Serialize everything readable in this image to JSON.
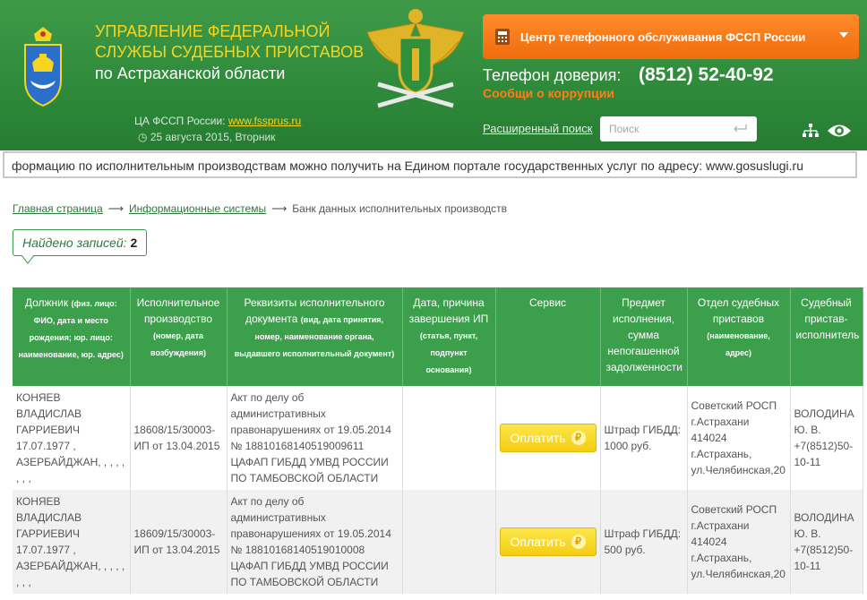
{
  "header": {
    "org_title_line1": "Управление Федеральной",
    "org_title_line2": "службы судебных приставов",
    "org_subtitle": "по Астраханской области",
    "ca_label": "ЦА ФССП России:",
    "ca_link": "www.fssprus.ru",
    "date": "25 августа 2015, Вторник",
    "call_center": "Центр телефонного обслуживания ФССП России",
    "trust_label": "Телефон доверия:",
    "trust_phone": "(8512) 52-40-92",
    "corruption": "Сообщи о коррупции",
    "advanced_search": "Расширенный поиск",
    "search_placeholder": "Поиск"
  },
  "ticker": "формацию по исполнительным производствам можно получить на Едином портале государственных услуг по адресу: www.gosuslugi.ru",
  "breadcrumb": {
    "home": "Главная страница",
    "systems": "Информационные системы",
    "current": "Банк данных исполнительных производств",
    "arrow": "⟶"
  },
  "found": {
    "label": "Найдено записей:",
    "count": "2"
  },
  "table": {
    "headers": [
      {
        "main": "Должник",
        "sub": "(физ. лицо: ФИО, дата и место рождения; юр. лицо: наименование, юр. адрес)"
      },
      {
        "main": "Исполнительное производство",
        "sub": "(номер, дата возбуждения)"
      },
      {
        "main": "Реквизиты исполнительного документа",
        "sub": "(вид, дата принятия, номер, наименование органа, выдавшего исполнительный документ)"
      },
      {
        "main": "Дата, причина завершения ИП",
        "sub": "(статья, пункт, подпункт основания)"
      },
      {
        "main": "Сервис",
        "sub": ""
      },
      {
        "main": "Предмет исполнения, сумма непогашенной задолженности",
        "sub": ""
      },
      {
        "main": "Отдел судебных приставов",
        "sub": "(наименование, адрес)"
      },
      {
        "main": "Судебный пристав-исполнитель",
        "sub": ""
      }
    ],
    "pay_label": "Оплатить",
    "rub": "₽",
    "rows": [
      {
        "debtor": "КОНЯЕВ ВЛАДИСЛАВ ГАРРИЕВИЧ 17.07.1977 , АЗЕРБАЙДЖАН, , , , , , , ,",
        "ip": "18608/15/30003-ИП от 13.04.2015",
        "doc": "Акт по делу об административных правонарушениях от 19.05.2014 № 18810168140519009611 ЦАФАП ГИБДД УМВД РОССИИ ПО ТАМБОВСКОЙ ОБЛАСТИ",
        "end": "",
        "subject": "Штраф ГИБДД: 1000 руб.",
        "department": "Советский РОСП г.Астрахани 414024 г.Астрахань, ул.Челябинская,20",
        "bailiff": "ВОЛОДИНА Ю. В. +7(8512)50-10-11"
      },
      {
        "debtor": "КОНЯЕВ ВЛАДИСЛАВ ГАРРИЕВИЧ 17.07.1977 , АЗЕРБАЙДЖАН, , , , , , , ,",
        "ip": "18609/15/30003-ИП от 13.04.2015",
        "doc": "Акт по делу об административных правонарушениях от 19.05.2014 № 18810168140519010008 ЦАФАП ГИБДД УМВД РОССИИ ПО ТАМБОВСКОЙ ОБЛАСТИ",
        "end": "",
        "subject": "Штраф ГИБДД: 500 руб.",
        "department": "Советский РОСП г.Астрахани 414024 г.Астрахань, ул.Челябинская,20",
        "bailiff": "ВОЛОДИНА Ю. В. +7(8512)50-10-11"
      }
    ]
  },
  "icons": {
    "region_logo": "astrakhan-emblem-icon",
    "fssp_emblem": "fssp-eagle-emblem-icon",
    "phone": "phone-icon",
    "enter": "enter-icon",
    "sitemap": "sitemap-icon",
    "accessibility": "eye-icon"
  },
  "colors": {
    "header_green": "#2e8a3a",
    "title_yellow": "#f6d51f",
    "orange": "#f06c0d",
    "table_header": "#3c9f4c",
    "pay_button": "#f4cd12"
  }
}
